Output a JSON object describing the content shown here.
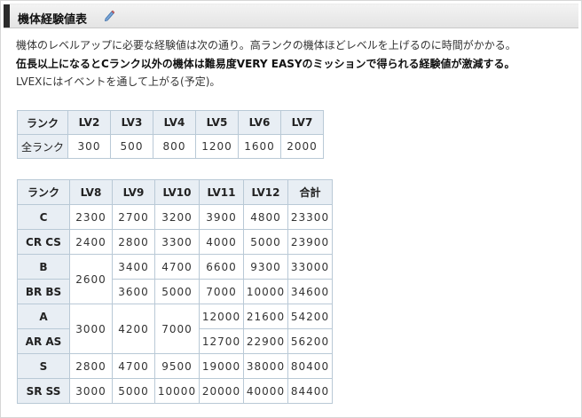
{
  "header": {
    "title": "機体経験値表"
  },
  "intro": {
    "line1": "機体のレベルアップに必要な経験値は次の通り。高ランクの機体ほどレベルを上げるのに時間がかかる。",
    "line2": "伍長以上になるとCランク以外の機体は難易度VERY EASYのミッションで得られる経験値が激減する。",
    "line3": "LVEXにはイベントを通して上がる(予定)。"
  },
  "table1": {
    "headers": [
      "ランク",
      "LV2",
      "LV3",
      "LV4",
      "LV5",
      "LV6",
      "LV7"
    ],
    "row_label": "全ランク",
    "values": [
      "300",
      "500",
      "800",
      "1200",
      "1600",
      "2000"
    ]
  },
  "table2": {
    "headers": [
      "ランク",
      "LV8",
      "LV9",
      "LV10",
      "LV11",
      "LV12",
      "合計"
    ],
    "rows": [
      {
        "label": "C",
        "lv8": "2300",
        "lv9": "2700",
        "lv10": "3200",
        "lv11": "3900",
        "lv12": "4800",
        "total": "23300"
      },
      {
        "label": "CR CS",
        "lv8": "2400",
        "lv9": "2800",
        "lv10": "3300",
        "lv11": "4000",
        "lv12": "5000",
        "total": "23900"
      },
      {
        "label": "B",
        "lv8": "2600",
        "lv9": "3400",
        "lv10": "4700",
        "lv11": "6600",
        "lv12": "9300",
        "total": "33000"
      },
      {
        "label": "BR BS",
        "lv9": "3600",
        "lv10": "5000",
        "lv11": "7000",
        "lv12": "10000",
        "total": "34600"
      },
      {
        "label": "A",
        "lv8": "3000",
        "lv9": "4200",
        "lv10": "7000",
        "lv11": "12000",
        "lv12": "21600",
        "total": "54200"
      },
      {
        "label": "AR AS",
        "lv11": "12700",
        "lv12": "22900",
        "total": "56200"
      },
      {
        "label": "S",
        "lv8": "2800",
        "lv9": "4700",
        "lv10": "9500",
        "lv11": "19000",
        "lv12": "38000",
        "total": "80400"
      },
      {
        "label": "SR SS",
        "lv8": "3000",
        "lv9": "5000",
        "lv10": "10000",
        "lv11": "20000",
        "lv12": "40000",
        "total": "84400"
      }
    ]
  },
  "colors": {
    "header_bg": "#e8eef4",
    "border": "#b9c9d6",
    "title_bar": "#2b2b2b"
  },
  "icons": {
    "edit": "pencil-icon"
  }
}
